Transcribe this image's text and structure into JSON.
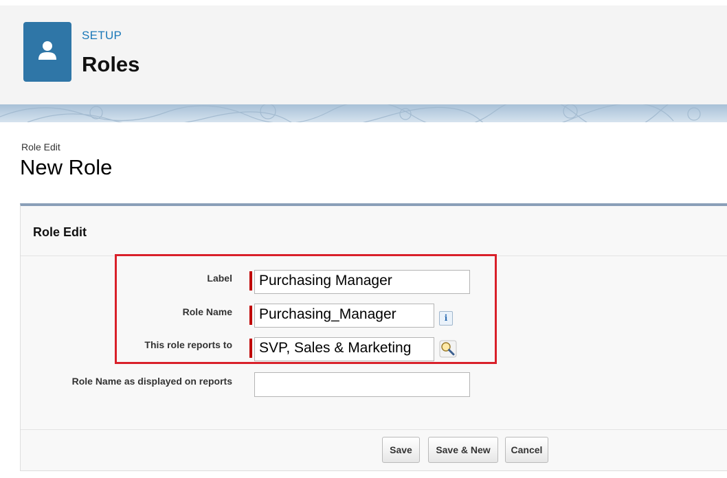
{
  "header": {
    "setup_label": "SETUP",
    "title": "Roles",
    "icon": "user-icon",
    "icon_bg": "#2f76a7"
  },
  "page": {
    "breadcrumb": "Role Edit",
    "title": "New Role"
  },
  "section": {
    "title": "Role Edit"
  },
  "fields": {
    "label": {
      "label": "Label",
      "value": "Purchasing Manager",
      "required": true
    },
    "role_name": {
      "label": "Role Name",
      "value": "Purchasing_Manager",
      "required": true,
      "help_icon": "info-icon"
    },
    "reports_to": {
      "label": "This role reports to",
      "value": "SVP, Sales & Marketing",
      "required": true,
      "lookup_icon": "lookup-icon"
    },
    "report_name": {
      "label": "Role Name as displayed on reports",
      "value": "",
      "required": false
    }
  },
  "buttons": {
    "save": "Save",
    "save_new": "Save & New",
    "cancel": "Cancel"
  },
  "colors": {
    "required_bar": "#c00000",
    "highlight_box": "#d9202a",
    "link": "#1a78b8"
  }
}
